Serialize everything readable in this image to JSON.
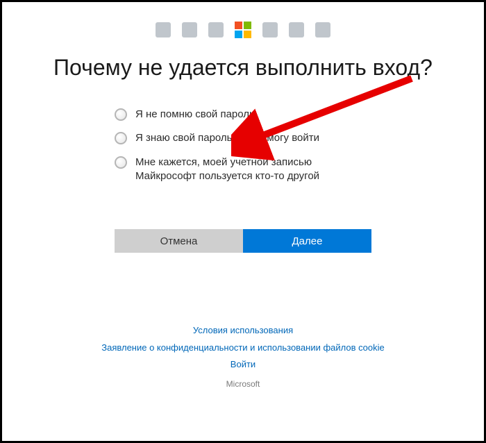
{
  "header": {
    "services": [
      "office-icon",
      "onedrive-icon",
      "outlook-icon",
      "microsoft-logo",
      "xbox-icon",
      "skype-icon",
      "bing-icon"
    ]
  },
  "heading": "Почему не удается выполнить вход?",
  "options": [
    {
      "id": "forgot",
      "label": "Я не помню свой пароль"
    },
    {
      "id": "know",
      "label": "Я знаю свой пароль, но не могу войти"
    },
    {
      "id": "hacked",
      "label": "Мне кажется, моей учетной записью Майкрософт пользуется кто-то другой"
    }
  ],
  "buttons": {
    "cancel": "Отмена",
    "next": "Далее"
  },
  "footer": {
    "terms": "Условия использования",
    "privacy": "Заявление о конфиденциальности и использовании файлов cookie",
    "signin": "Войти",
    "brand": "Microsoft"
  },
  "annotation": {
    "arrow_color": "#e60000",
    "arrow_target": "options.0"
  }
}
